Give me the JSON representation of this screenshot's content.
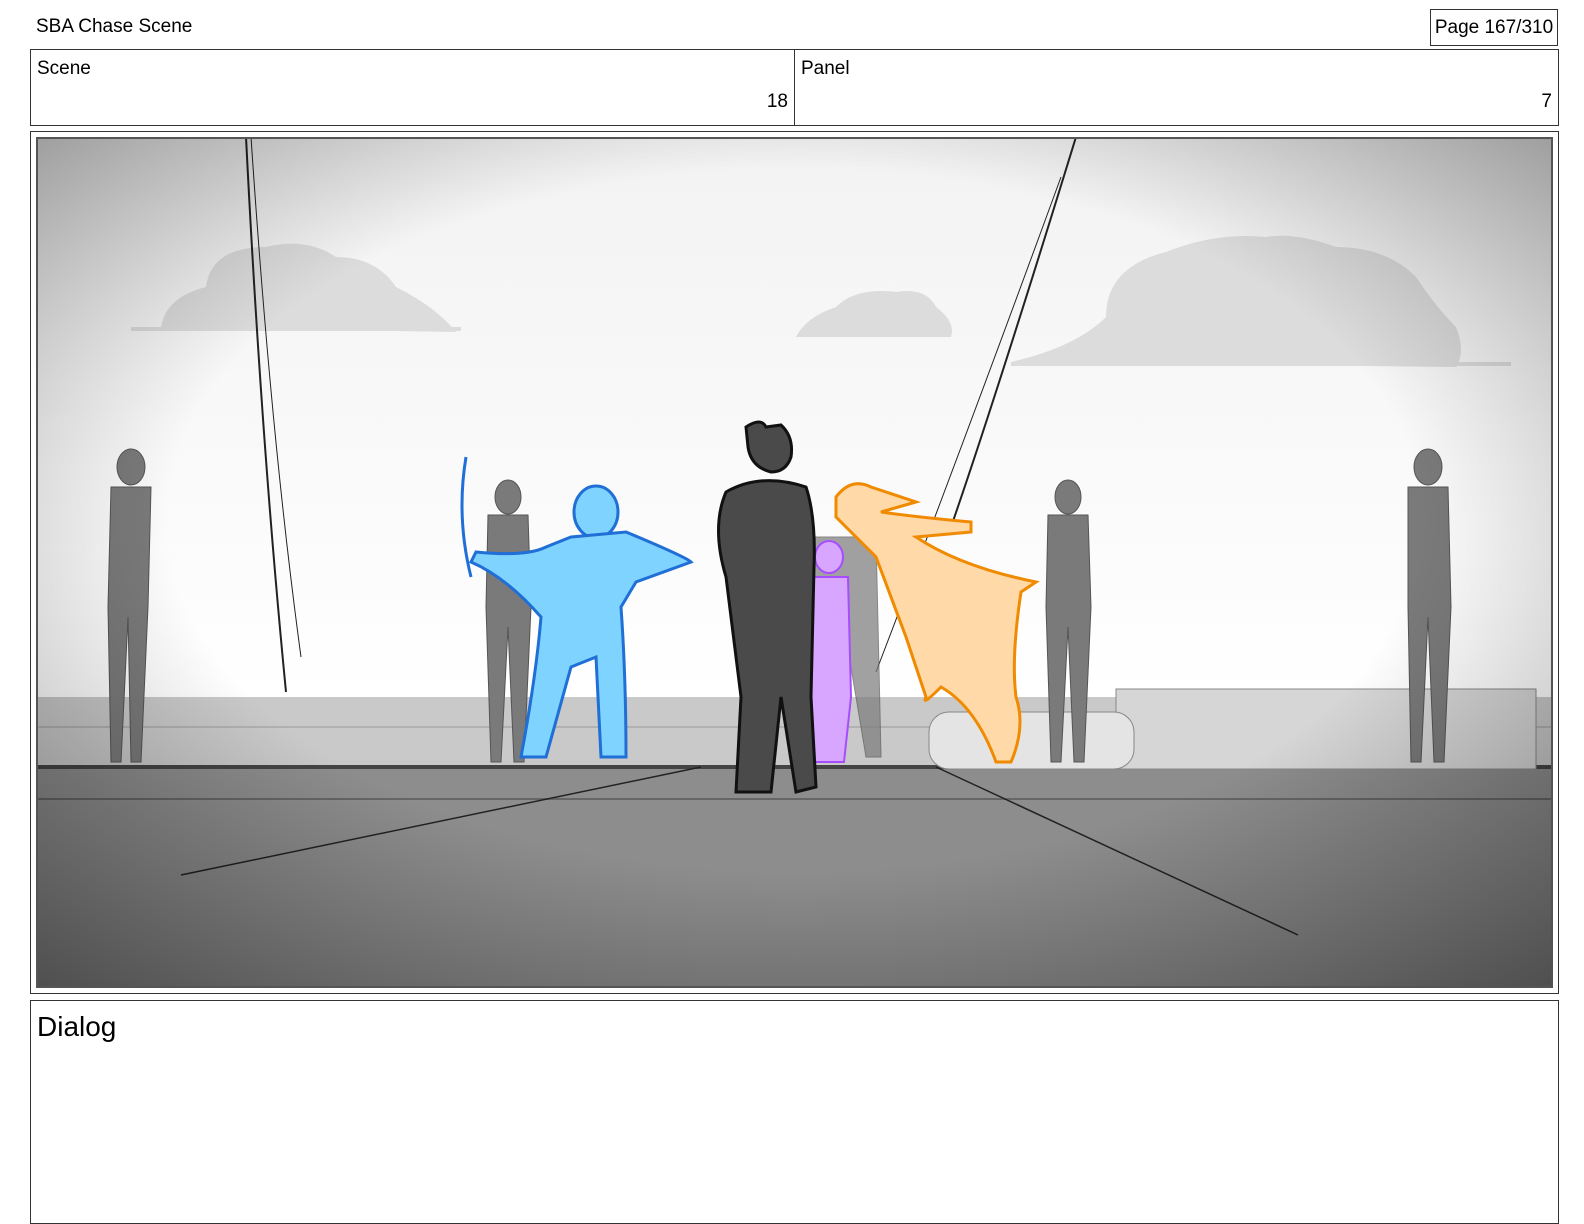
{
  "header": {
    "project_title": "SBA Chase Scene",
    "page": "Page 167/310"
  },
  "info": {
    "scene_label": "Scene",
    "scene_value": "18",
    "panel_label": "Panel",
    "panel_value": "7"
  },
  "dialog": {
    "label": "Dialog"
  },
  "colors": {
    "blue_character": "#7fd3ff",
    "blue_outline": "#1f6fd6",
    "orange_character": "#ffd9a8",
    "orange_outline": "#f08a00",
    "purple_character": "#d9a6ff",
    "ink_character": "#4a4a4a",
    "bystander": "#7a7a7a",
    "cloud": "#dcdcdc"
  }
}
